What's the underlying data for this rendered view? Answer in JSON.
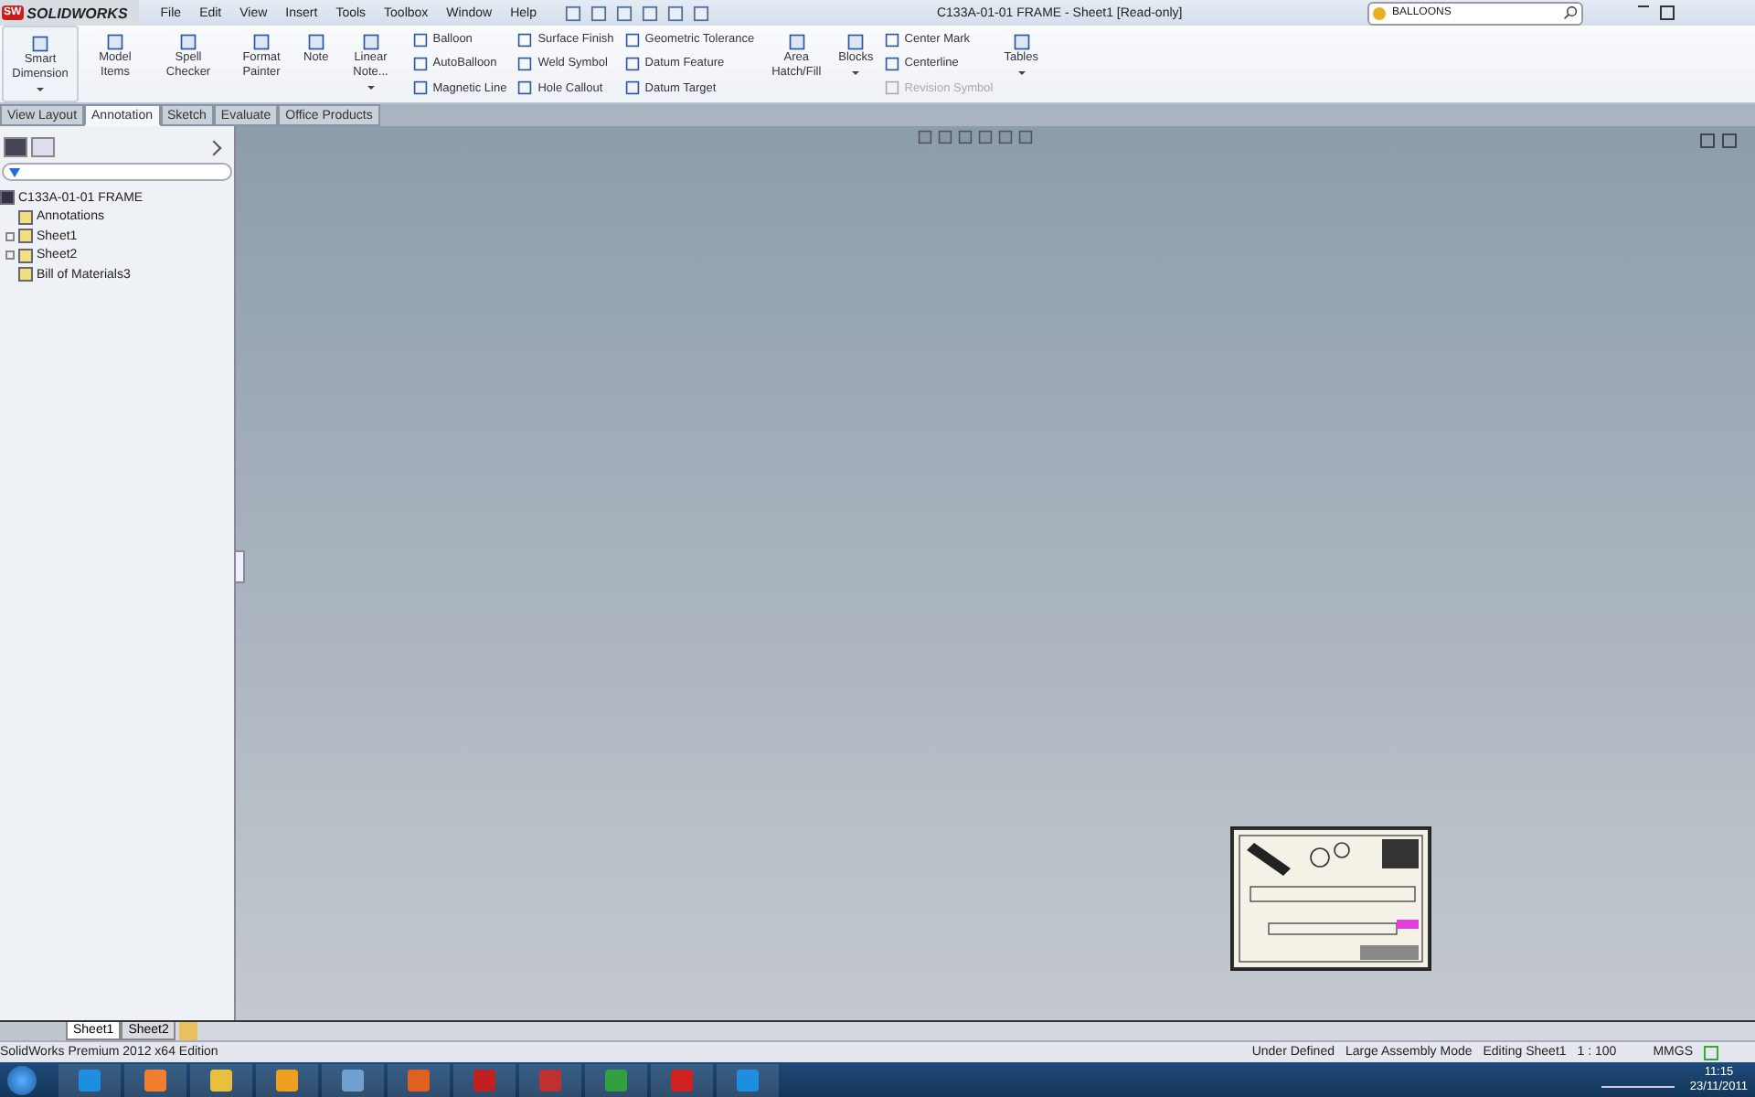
{
  "app": {
    "badge": "SW",
    "logo": "SOLIDWORKS",
    "menu": [
      "File",
      "Edit",
      "View",
      "Insert",
      "Tools",
      "Toolbox",
      "Window",
      "Help"
    ],
    "title": "C133A-01-01 FRAME - Sheet1 [Read-only]",
    "search": {
      "value": "BALLOONS"
    }
  },
  "ribbon": [
    {
      "kind": "large",
      "label": "Smart Dimension",
      "dropdown": true
    },
    {
      "kind": "large",
      "label": "Model Items",
      "dropdown": false
    },
    {
      "kind": "large",
      "label": "Spell Checker",
      "dropdown": false
    },
    {
      "kind": "large",
      "label": "Format Painter",
      "dropdown": false
    },
    {
      "kind": "large",
      "label": "Note",
      "dropdown": false
    },
    {
      "kind": "large",
      "label": "Linear Note...",
      "dropdown": true
    },
    {
      "kind": "stack",
      "items": [
        {
          "label": "Balloon",
          "disabled": false
        },
        {
          "label": "AutoBalloon",
          "disabled": false
        },
        {
          "label": "Magnetic Line",
          "disabled": false
        }
      ]
    },
    {
      "kind": "stack",
      "items": [
        {
          "label": "Surface Finish",
          "disabled": false
        },
        {
          "label": "Weld Symbol",
          "disabled": false
        },
        {
          "label": "Hole Callout",
          "disabled": false
        }
      ]
    },
    {
      "kind": "stack",
      "items": [
        {
          "label": "Geometric Tolerance",
          "disabled": false
        },
        {
          "label": "Datum Feature",
          "disabled": false
        },
        {
          "label": "Datum Target",
          "disabled": false
        }
      ]
    },
    {
      "kind": "large",
      "label": "Area Hatch/Fill",
      "dropdown": false
    },
    {
      "kind": "large",
      "label": "Blocks",
      "dropdown": true
    },
    {
      "kind": "stack",
      "items": [
        {
          "label": "Center Mark",
          "disabled": false
        },
        {
          "label": "Centerline",
          "disabled": false
        },
        {
          "label": "Revision Symbol",
          "disabled": true
        }
      ]
    },
    {
      "kind": "large",
      "label": "Tables",
      "dropdown": true
    }
  ],
  "tabs": [
    {
      "label": "View Layout",
      "selected": false
    },
    {
      "label": "Annotation",
      "selected": true
    },
    {
      "label": "Sketch",
      "selected": false
    },
    {
      "label": "Evaluate",
      "selected": false
    },
    {
      "label": "Office Products",
      "selected": false
    }
  ],
  "tree": {
    "label": "C133A-01-01 FRAME",
    "children": [
      {
        "label": "Annotations",
        "expander": false
      },
      {
        "label": "Sheet1",
        "expander": true
      },
      {
        "label": "Sheet2",
        "expander": true
      },
      {
        "label": "Bill of Materials3",
        "expander": false
      }
    ]
  },
  "sheet_tabs": [
    {
      "label": "Sheet1",
      "selected": true
    },
    {
      "label": "Sheet2",
      "selected": false
    }
  ],
  "status_bar": {
    "edition": "SolidWorks Premium 2012 x64 Edition",
    "fields": [
      "Under Defined",
      "Large Assembly Mode",
      "Editing Sheet1",
      "1 : 100"
    ],
    "units": "MMGS"
  },
  "taskbar": {
    "time": "11:15",
    "date": "23/11/2011"
  }
}
